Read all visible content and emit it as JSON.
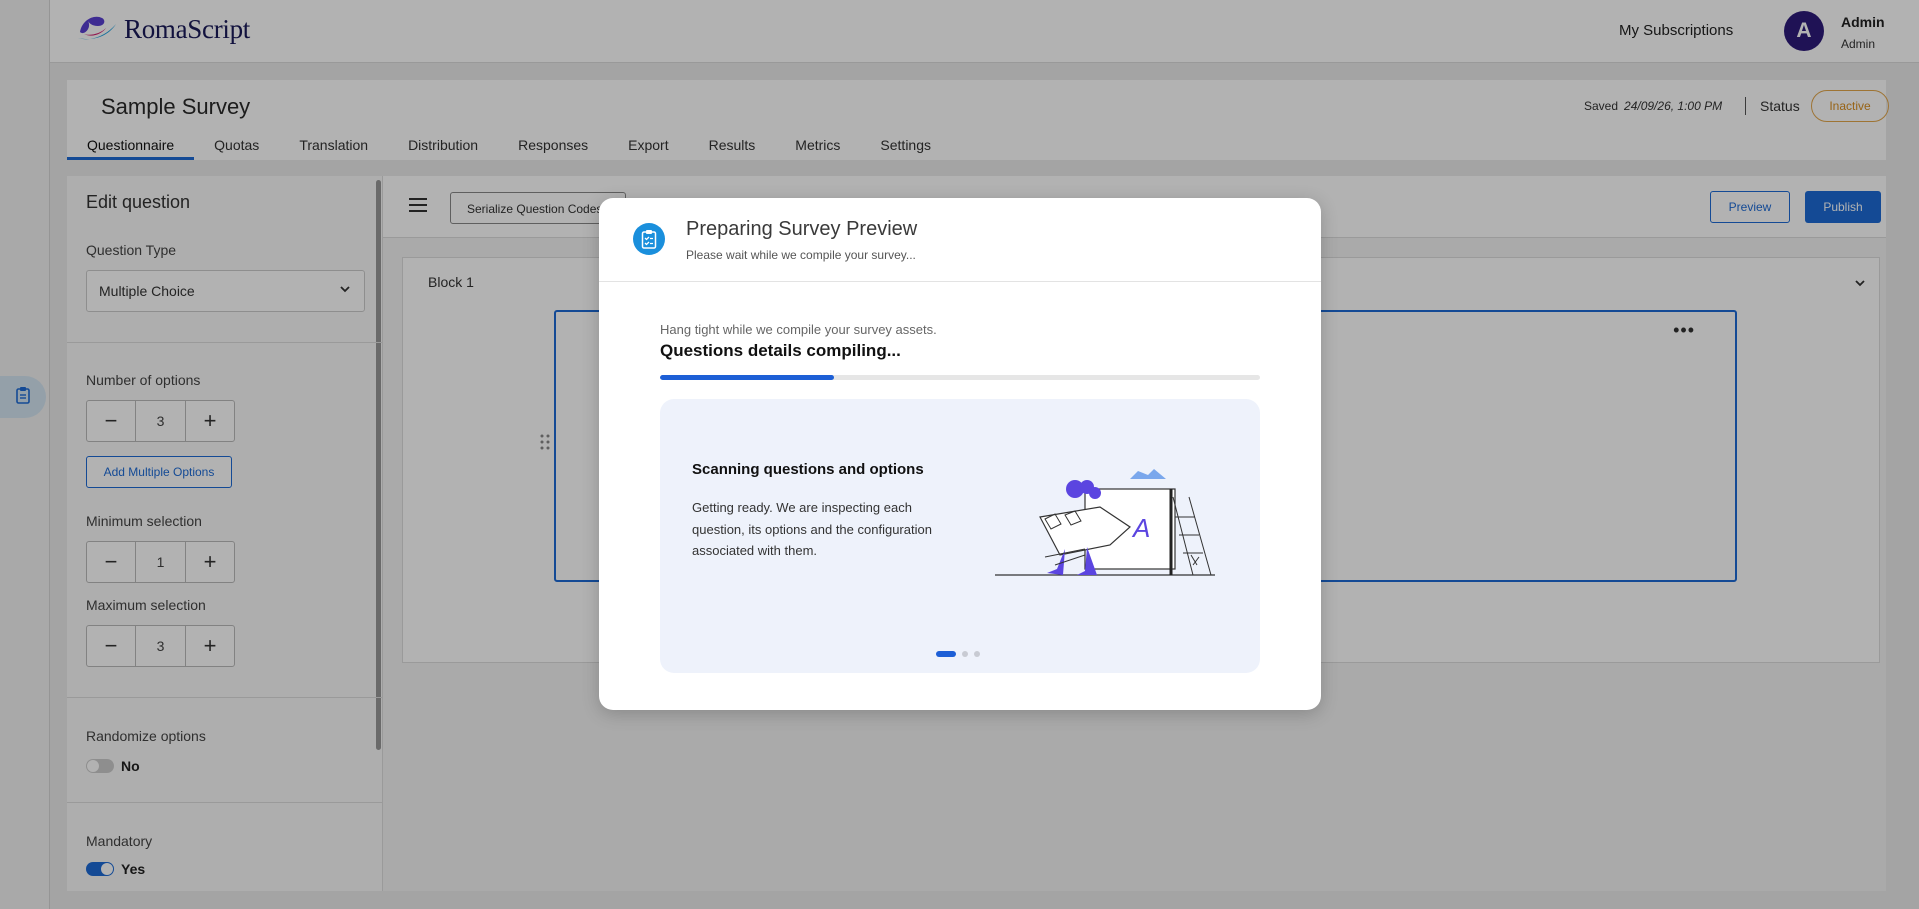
{
  "app": {
    "name": "RomaScript"
  },
  "topbar": {
    "subscriptions_label": "My Subscriptions",
    "avatar_initial": "A",
    "user_name": "Admin",
    "user_role": "Admin"
  },
  "survey": {
    "title": "Sample Survey",
    "saved_label": "Saved",
    "saved_time": "24/09/26, 1:00 PM",
    "status_label": "Status",
    "status_value": "Inactive"
  },
  "tabs": [
    {
      "label": "Questionnaire",
      "active": true
    },
    {
      "label": "Quotas"
    },
    {
      "label": "Translation"
    },
    {
      "label": "Distribution"
    },
    {
      "label": "Responses"
    },
    {
      "label": "Export"
    },
    {
      "label": "Results"
    },
    {
      "label": "Metrics"
    },
    {
      "label": "Settings"
    }
  ],
  "editor": {
    "heading": "Edit question",
    "question_type_label": "Question Type",
    "question_type_value": "Multiple Choice",
    "num_options_label": "Number of options",
    "num_options_value": "3",
    "add_multiple_options": "Add Multiple Options",
    "min_selection_label": "Minimum selection",
    "min_selection_value": "1",
    "max_selection_label": "Maximum selection",
    "max_selection_value": "3",
    "randomize_label": "Randomize options",
    "randomize_value": "No",
    "mandatory_label": "Mandatory",
    "mandatory_value": "Yes"
  },
  "toolbar": {
    "serialize_label": "Serialize Question Codes",
    "preview_label": "Preview",
    "publish_label": "Publish"
  },
  "block": {
    "title": "Block 1",
    "menu_glyph": "•••"
  },
  "modal": {
    "title": "Preparing Survey Preview",
    "subtitle": "Please wait while we compile your survey...",
    "intro": "Hang tight while we compile your survey assets.",
    "status": "Questions details compiling...",
    "progress": 0.29,
    "card_title": "Scanning questions and options",
    "card_text": "Getting ready. We are inspecting each question, its options and the configuration associated with them.",
    "slides": 3,
    "active_slide": 0
  },
  "colors": {
    "accent": "#1d6bd6",
    "status_inactive": "#d98f1f",
    "avatar": "#2d1b7a",
    "modal_icon": "#1a8fdc"
  }
}
